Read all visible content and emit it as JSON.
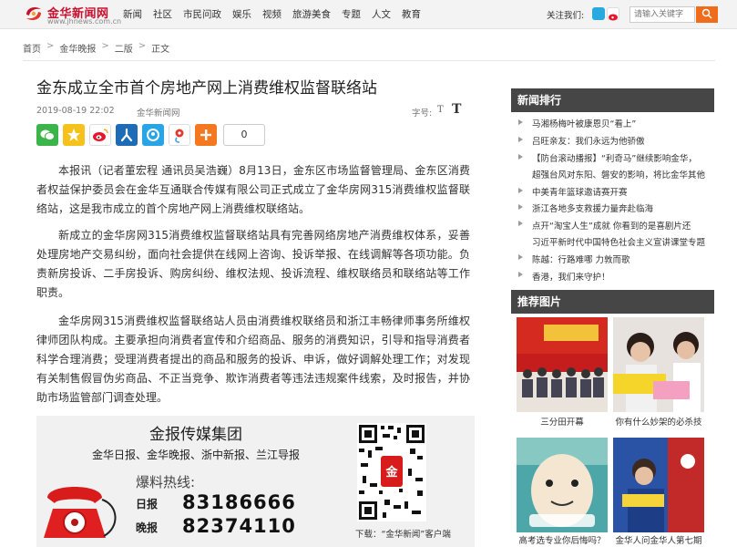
{
  "header": {
    "logo_cn": "金华新闻网",
    "logo_en": "www.jhnews.com.cn",
    "nav": [
      "新闻",
      "社区",
      "市民问政",
      "娱乐",
      "视频",
      "旅游美食",
      "专题",
      "人文",
      "教育"
    ],
    "follow_label": "关注我们:",
    "search_placeholder": "请输入关键字"
  },
  "breadcrumb": [
    "首页",
    "金华晚报",
    "二版",
    "正文"
  ],
  "article": {
    "title": "金东成立全市首个房地产网上消费维权监督联络站",
    "date": "2019-08-19 22:02",
    "source": "金华新闻网",
    "font_label": "字号:",
    "font_small": "T",
    "font_large": "T",
    "share_count": "0",
    "paragraphs": [
      "本报讯（记者董宏程 通讯员吴浩巍）8月13日，金东区市场监督管理局、金东区消费者权益保护委员会在金华互通联合传媒有限公司正式成立了金华房网315消费维权监督联络站，这是我市成立的首个房地产网上消费维权联络站。",
      "新成立的金华房网315消费维权监督联络站具有完善网络房地产消费维权体系，妥善处理房地产交易纠纷，面向社会提供在线网上咨询、投诉举报、在线调解等各项功能。负责新房投诉、二手房投诉、购房纠纷、维权法规、投诉流程、维权联络员和联络站等工作职责。",
      "金华房网315消费维权监督联络站人员由消费维权联络员和浙江丰畅律师事务所维权律师团队构成。主要承担向消费者宣传和介绍商品、服务的消费知识，引导和指导消费者科学合理消费；受理消费者提出的商品和服务的投诉、申诉，做好调解处理工作；对发现有关制售假冒伪劣商品、不正当竞争、欺诈消费者等违法违规案件线索，及时报告，并协助市场监管部门调查处理。"
    ]
  },
  "ad": {
    "title": "金报传媒集团",
    "papers": "金华日报、金华晚报、浙中新报、兰江导报",
    "hotline_label": "爆料热线:",
    "line1_label": "日报",
    "line1_number": "83186666",
    "line2_label": "晚报",
    "line2_number": "82374110",
    "download": "下载：“金华新闻”客户端"
  },
  "sidebar": {
    "rank_title": "新闻排行",
    "rank_items": [
      "马湘杨梅叶被康恩贝“看上”",
      "吕旺亲友：我们永远为他骄傲",
      "【防台滚动播报】“利奇马”继续影响金华，",
      "超强台风对东阳、磐安的影响，将比金华其他",
      "中美青年篮球邀请赛开赛",
      "浙江各地多支救援力量奔赴临海",
      "点开“淘宝人生”成就 你看到的是喜剧片还",
      "习近平新时代中国特色社会主义宣讲课堂专题",
      "陈越：行路难哪 力敦而歌",
      "香港，我们来守护！"
    ],
    "pics_title": "推荐图片",
    "pics": [
      {
        "caption": "三分田开幕"
      },
      {
        "caption": "你有什么妙架的必杀技"
      },
      {
        "caption": "高考选专业你后悔吗？"
      },
      {
        "caption": "金华人问金华人第七期"
      }
    ]
  },
  "colors": {
    "brand": "#c8102e",
    "search_btn": "#f06b1a",
    "sidebar_head": "#464646"
  }
}
